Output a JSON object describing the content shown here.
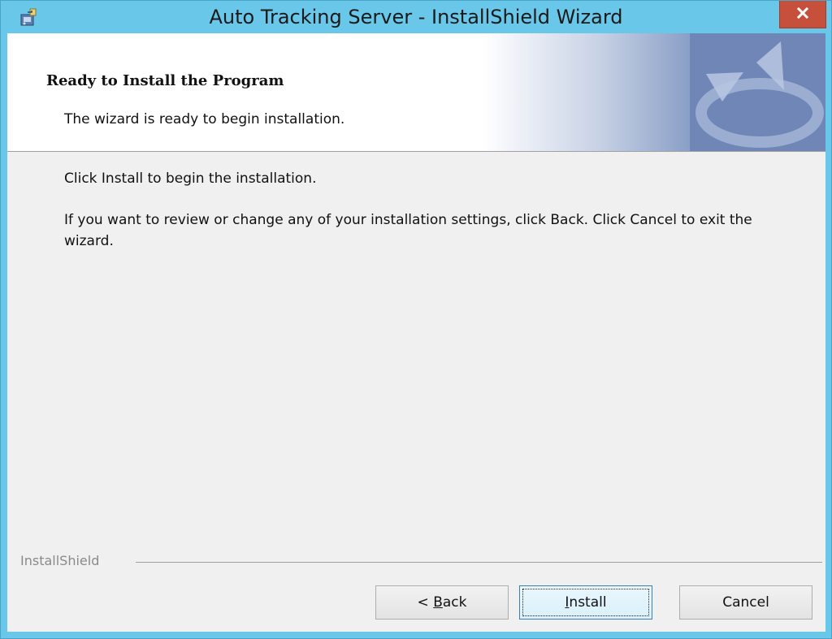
{
  "window": {
    "title": "Auto Tracking Server - InstallShield Wizard",
    "close_glyph": "x",
    "titlebar_color": "#69c7ea",
    "close_color": "#c7503d"
  },
  "header": {
    "title": "Ready to Install the Program",
    "subtitle": "The wizard is ready to begin installation."
  },
  "body": {
    "line1": "Click Install to begin the installation.",
    "line2": "If you want to review or change any of your installation settings, click Back. Click Cancel to exit the wizard."
  },
  "footer": {
    "brand": "InstallShield",
    "buttons": {
      "back_prefix": "< ",
      "back_mnemonic": "B",
      "back_rest": "ack",
      "install_mnemonic": "I",
      "install_rest": "nstall",
      "cancel": "Cancel"
    }
  },
  "icons": {
    "app": "installer-icon",
    "close": "close-icon",
    "logo": "installshield-logo-icon"
  }
}
